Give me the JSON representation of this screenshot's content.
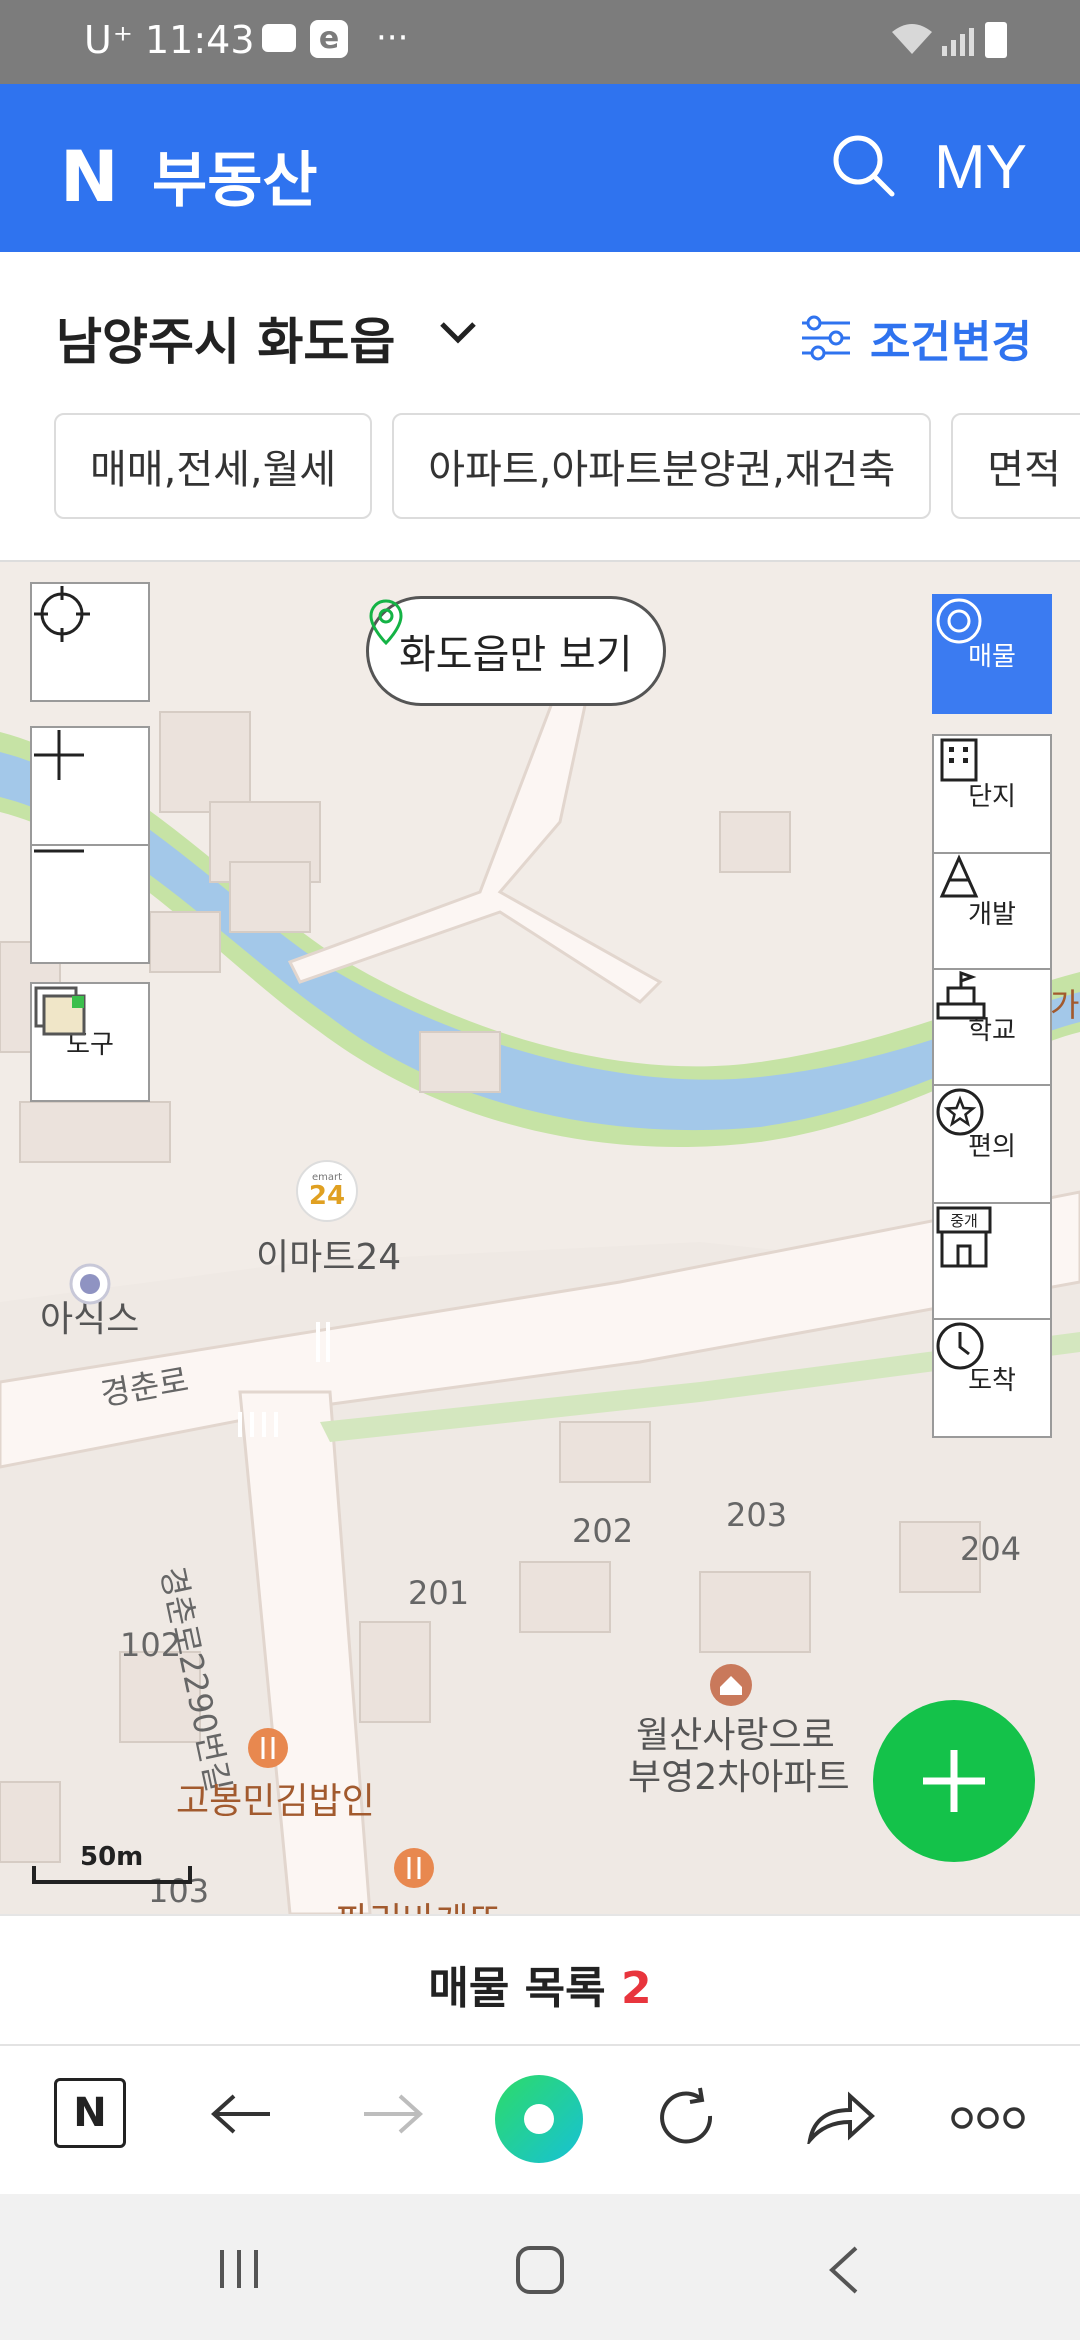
{
  "status_bar": {
    "carrier": "U⁺",
    "time": "11:43",
    "app_badge": "e",
    "more": "···"
  },
  "header": {
    "logo": "N",
    "title": "부동산",
    "my_label": "MY"
  },
  "location": {
    "title": "남양주시 화도읍",
    "filter_label": "조건변경"
  },
  "chips": [
    {
      "label": "매매,전세,월세"
    },
    {
      "label": "아파트,아파트분양권,재건축"
    },
    {
      "label": "면적"
    }
  ],
  "map": {
    "only_area_label": "화도읍만 보기",
    "tool_label": "도구",
    "side_controls": [
      {
        "label": "매물",
        "icon": "target-icon",
        "active": true
      },
      {
        "label": "단지",
        "icon": "building-icon",
        "active": false
      },
      {
        "label": "개발",
        "icon": "cone-icon",
        "active": false
      },
      {
        "label": "학교",
        "icon": "school-icon",
        "active": false
      },
      {
        "label": "편의",
        "icon": "star-icon",
        "active": false
      },
      {
        "label": "중개",
        "icon": "store-icon",
        "active": false
      },
      {
        "label": "도착",
        "icon": "clock-icon",
        "active": false
      }
    ],
    "store_badge": "24",
    "store_badge_top": "emart",
    "side_control_store_sub": "중개",
    "place_labels": {
      "emart24": "이마트24",
      "asics": "아식스",
      "road_main": "경춘로",
      "road_side": "경춘로2290번길",
      "b102": "102",
      "b201": "201",
      "b202": "202",
      "b203": "203",
      "b204": "204",
      "b103": "103",
      "apt_line1": "월산사랑으로",
      "apt_line2": "부영2차아파트",
      "restaurant": "고봉민김밥인",
      "bakery": "파리바게뜨",
      "partial_right": "가"
    },
    "scale": "50m"
  },
  "list_bar": {
    "label": "매물 목록",
    "count": "2"
  },
  "browser_toolbar": {
    "home": "N"
  },
  "colors": {
    "brand": "#2f73ef",
    "fab": "#14c24a",
    "count_red": "#e8353d"
  }
}
